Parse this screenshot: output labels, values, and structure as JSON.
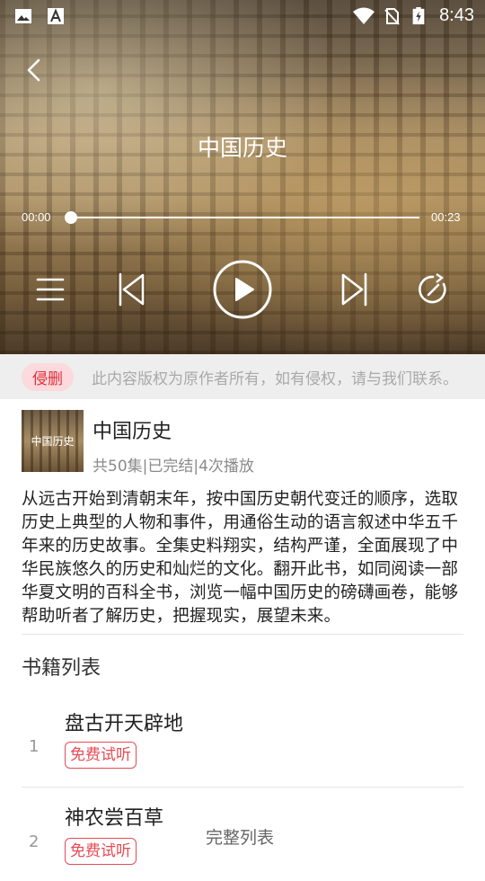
{
  "status_bar": {
    "time": "8:43"
  },
  "player": {
    "title": "中国历史",
    "current_time": "00:00",
    "total_time": "00:23",
    "progress": 0
  },
  "notice": {
    "tag": "侵删",
    "text": "此内容版权为原作者所有，如有侵权，请与我们联系。"
  },
  "book": {
    "cover_text": "中国历史",
    "title": "中国历史",
    "meta": "共50集|已完结|4次播放",
    "description": "从远古开始到清朝末年，按中国历史朝代变迁的顺序，选取历史上典型的人物和事件，用通俗生动的语言叙述中华五千年来的历史故事。全集史料翔实，结构严谨，全面展现了中华民族悠久的历史和灿烂的文化。翻开此书，如同阅读一部华夏文明的百科全书，浏览一幅中国历史的磅礴画卷，能够帮助听者了解历史，把握现实，展望未来。"
  },
  "episode_list": {
    "heading": "书籍列表",
    "items": [
      {
        "num": "1",
        "title": "盘古开天辟地",
        "tag": "免费试听"
      },
      {
        "num": "2",
        "title": "神农尝百草",
        "tag": "免费试听"
      }
    ],
    "full_list_label": "完整列表"
  },
  "colors": {
    "accent_red": "#e84a53",
    "tag_bg": "#fbd9dc",
    "notice_bg": "#eeeeee"
  }
}
